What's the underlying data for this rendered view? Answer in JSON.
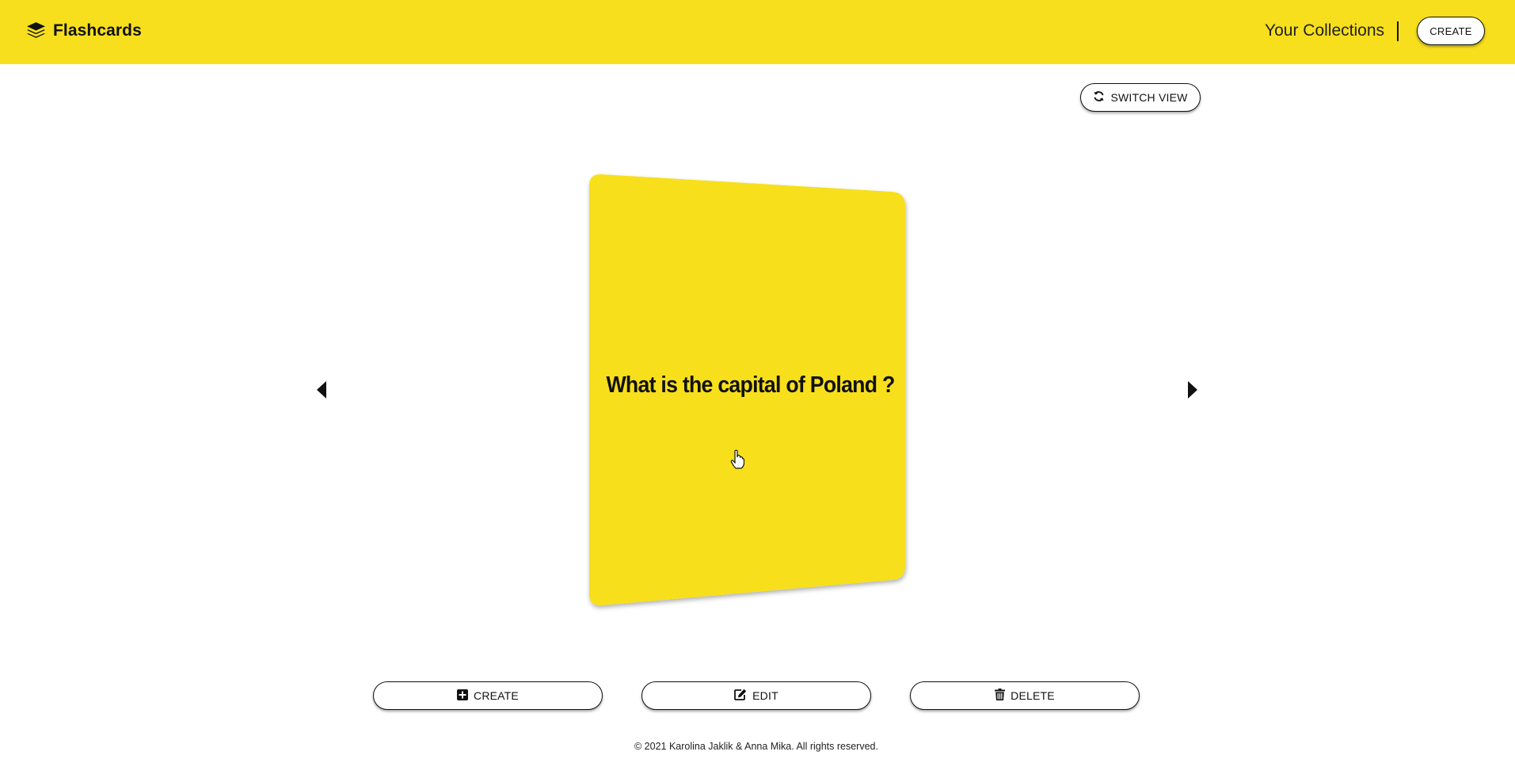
{
  "header": {
    "brand_name": "Flashcards",
    "brand_icon": "layers-icon",
    "collections_link": "Your Collections",
    "create_label": "CREATE",
    "background": "#f7df1e"
  },
  "view": {
    "switch_label": "SWITCH VIEW",
    "switch_icon": "refresh-icon"
  },
  "flashcard": {
    "question": "What is the capital of Poland ?",
    "color": "#f7df1e"
  },
  "navigation": {
    "prev_icon": "caret-left-icon",
    "next_icon": "caret-right-icon"
  },
  "actions": {
    "create_label": "CREATE",
    "edit_label": "EDIT",
    "delete_label": "DELETE",
    "create_icon": "plus-square-icon",
    "edit_icon": "edit-icon",
    "delete_icon": "trash-icon"
  },
  "footer": {
    "copyright": "© 2021 Karolina Jaklik & Anna Mika. All rights reserved."
  }
}
